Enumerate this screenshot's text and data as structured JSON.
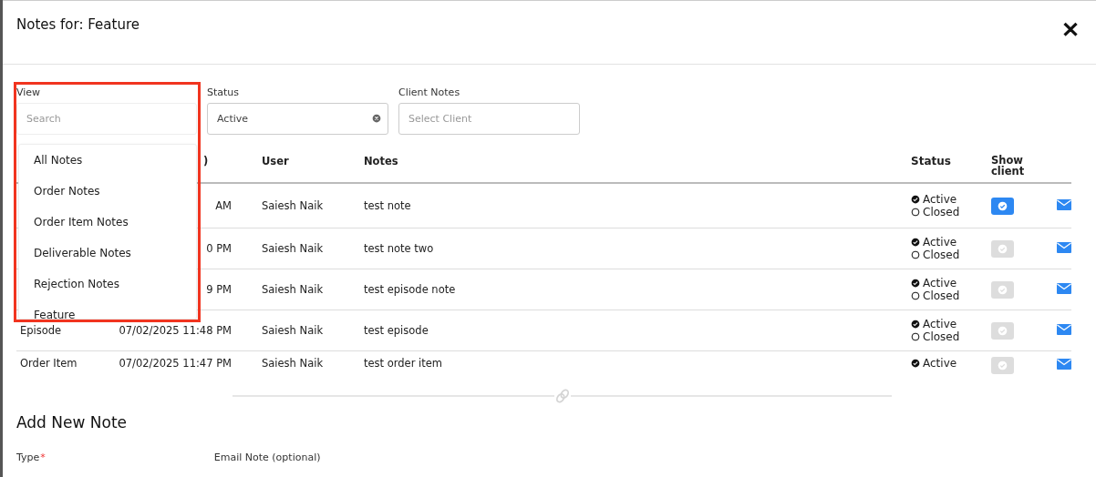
{
  "modal": {
    "title": "Notes for: Feature",
    "close": "✕"
  },
  "filters": [
    {
      "kind": "search",
      "label": "View",
      "placeholder": "Search"
    },
    {
      "kind": "select",
      "label": "Status",
      "value": "Active",
      "clearable": true
    },
    {
      "kind": "select",
      "label": "Client Notes",
      "placeholder": "Select Client",
      "clearable": false
    }
  ],
  "view_dropdown": {
    "items": [
      {
        "label": "All Notes"
      },
      {
        "label": "Order Notes"
      },
      {
        "label": "Order Item Notes"
      },
      {
        "label": "Deliverable Notes"
      },
      {
        "label": "Rejection Notes"
      },
      {
        "label": "Feature"
      }
    ]
  },
  "table": {
    "columns": [
      {
        "label": ")"
      },
      {
        "label": "User"
      },
      {
        "label": "Notes"
      },
      {
        "label": "Status"
      },
      {
        "label": "Show client"
      }
    ],
    "rows": [
      {
        "date": "AM",
        "user": "Saiesh Naik",
        "notes": "test note",
        "status": [
          {
            "label": "Active",
            "selected": true
          },
          {
            "label": "Closed",
            "selected": false
          }
        ],
        "show_client": true
      },
      {
        "date": "0 PM",
        "user": "Saiesh Naik",
        "notes": "test note two",
        "status": [
          {
            "label": "Active",
            "selected": true
          },
          {
            "label": "Closed",
            "selected": false
          }
        ],
        "show_client": false
      },
      {
        "date": "9 PM",
        "user": "Saiesh Naik",
        "notes": "test episode note",
        "status": [
          {
            "label": "Active",
            "selected": true
          },
          {
            "label": "Closed",
            "selected": false
          }
        ],
        "show_client": false
      },
      {
        "type": "Episode",
        "date": "07/02/2025 11:48 PM",
        "user": "Saiesh Naik",
        "notes": "test episode",
        "status": [
          {
            "label": "Active",
            "selected": true
          },
          {
            "label": "Closed",
            "selected": false
          }
        ],
        "show_client": false
      },
      {
        "type": "Order Item",
        "date": "07/02/2025 11:47 PM",
        "user": "Saiesh Naik",
        "notes": "test order item",
        "status": [
          {
            "label": "Active",
            "selected": true
          }
        ],
        "show_client": false
      }
    ]
  },
  "add_note": {
    "title": "Add New Note",
    "fields": [
      {
        "label": "Type",
        "required_mark": "*"
      },
      {
        "label": "Email Note (optional)"
      }
    ]
  }
}
